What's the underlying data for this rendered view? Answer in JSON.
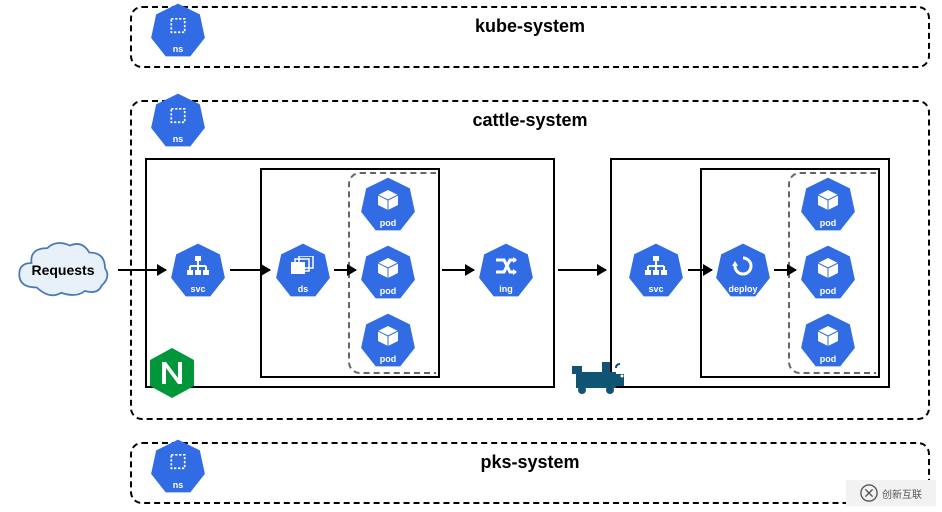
{
  "diagram": {
    "request_label": "Requests",
    "namespaces": {
      "kube": {
        "title": "kube-system",
        "icon_label": "ns"
      },
      "cattle": {
        "title": "cattle-system",
        "icon_label": "ns"
      },
      "pks": {
        "title": "pks-system",
        "icon_label": "ns"
      }
    },
    "nodes": {
      "svc1": "svc",
      "ds": "ds",
      "pod": "pod",
      "ing": "ing",
      "svc2": "svc",
      "deploy": "deploy"
    },
    "logos": {
      "nginx": "nginx-logo",
      "rancher": "rancher-logo"
    },
    "watermark": "创新互联",
    "colors": {
      "k8s_blue": "#326CE5",
      "nginx_green": "#009639",
      "rancher_teal": "#0F5474"
    }
  }
}
